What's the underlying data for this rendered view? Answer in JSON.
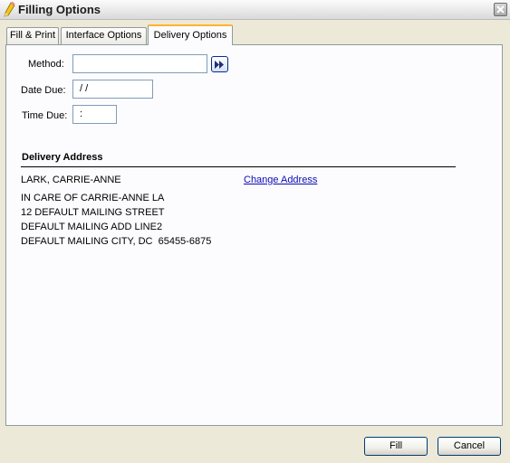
{
  "window": {
    "title": "Filling Options",
    "icon": "pencil-app-icon",
    "close_icon": "close-icon"
  },
  "tabs": [
    {
      "label": "Fill & Print",
      "active": false
    },
    {
      "label": "Interface Options",
      "active": false
    },
    {
      "label": "Delivery Options",
      "active": true
    }
  ],
  "form": {
    "method": {
      "label": "Method:",
      "value": "",
      "browse_icon": "double-arrow-right-icon"
    },
    "date_due": {
      "label": "Date Due:",
      "value": " / /"
    },
    "time_due": {
      "label": "Time Due:",
      "value": " :"
    }
  },
  "delivery_address": {
    "heading": "Delivery Address",
    "name": "LARK, CARRIE-ANNE",
    "change_link": "Change Address",
    "lines": [
      "IN CARE OF CARRIE-ANNE LA",
      "12 DEFAULT MAILING STREET",
      "DEFAULT MAILING ADD LINE2",
      "DEFAULT MAILING CITY, DC  65455-6875"
    ]
  },
  "buttons": {
    "fill": "Fill",
    "cancel": "Cancel"
  },
  "colors": {
    "dialog_bg": "#ece9d8",
    "panel_bg": "#fcfcfe",
    "active_tab_accent": "#ffb52e",
    "link": "#0b0bb4",
    "input_border": "#7f9db9"
  }
}
